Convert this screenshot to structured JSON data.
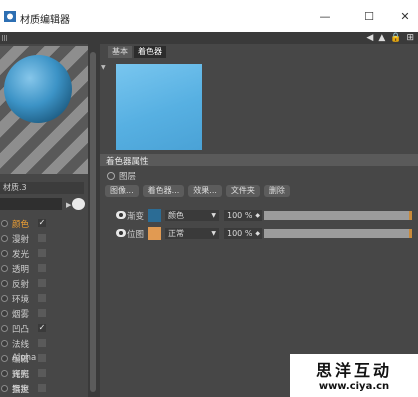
{
  "window": {
    "title": "材质编辑器",
    "minimize": "—",
    "maximize": "☐",
    "close": "✕"
  },
  "left_panel": {
    "material_name": "材质.3",
    "channels": [
      {
        "label": "颜色",
        "checked": true,
        "active": true
      },
      {
        "label": "漫射",
        "checked": false,
        "active": false
      },
      {
        "label": "发光",
        "checked": false,
        "active": false
      },
      {
        "label": "透明",
        "checked": false,
        "active": false
      },
      {
        "label": "反射",
        "checked": false,
        "active": false
      },
      {
        "label": "环境",
        "checked": false,
        "active": false
      },
      {
        "label": "烟雾",
        "checked": false,
        "active": false
      },
      {
        "label": "凹凸",
        "checked": true,
        "active": false
      },
      {
        "label": "法线",
        "checked": false,
        "active": false
      },
      {
        "label": "Alpha",
        "checked": false,
        "active": false
      },
      {
        "label": "辉光",
        "checked": false,
        "active": false
      },
      {
        "label": "置换",
        "checked": false,
        "active": false
      }
    ],
    "extras": [
      "编辑",
      "光照",
      "指定"
    ]
  },
  "right_panel": {
    "tabs": [
      {
        "label": "基本",
        "selected": false
      },
      {
        "label": "着色器",
        "selected": true
      }
    ],
    "section_title": "着色器属性",
    "layer_label": "图层",
    "buttons": [
      "图像...",
      "着色器...",
      "效果...",
      "文件夹",
      "删除"
    ],
    "layers": [
      {
        "name": "渐变",
        "color": "#2b6c95",
        "mode": "颜色",
        "opacity": "100 %",
        "fill": 1.0
      },
      {
        "name": "位图",
        "color": "#e19a52",
        "mode": "正常",
        "opacity": "100 %",
        "fill": 1.0
      }
    ]
  },
  "watermark": {
    "title": "思洋互动",
    "url": "www.ciya.cn"
  },
  "colors": {
    "panel": "#474747",
    "accent_orange": "#f0a033",
    "preview_blue": "#57b0e2"
  }
}
